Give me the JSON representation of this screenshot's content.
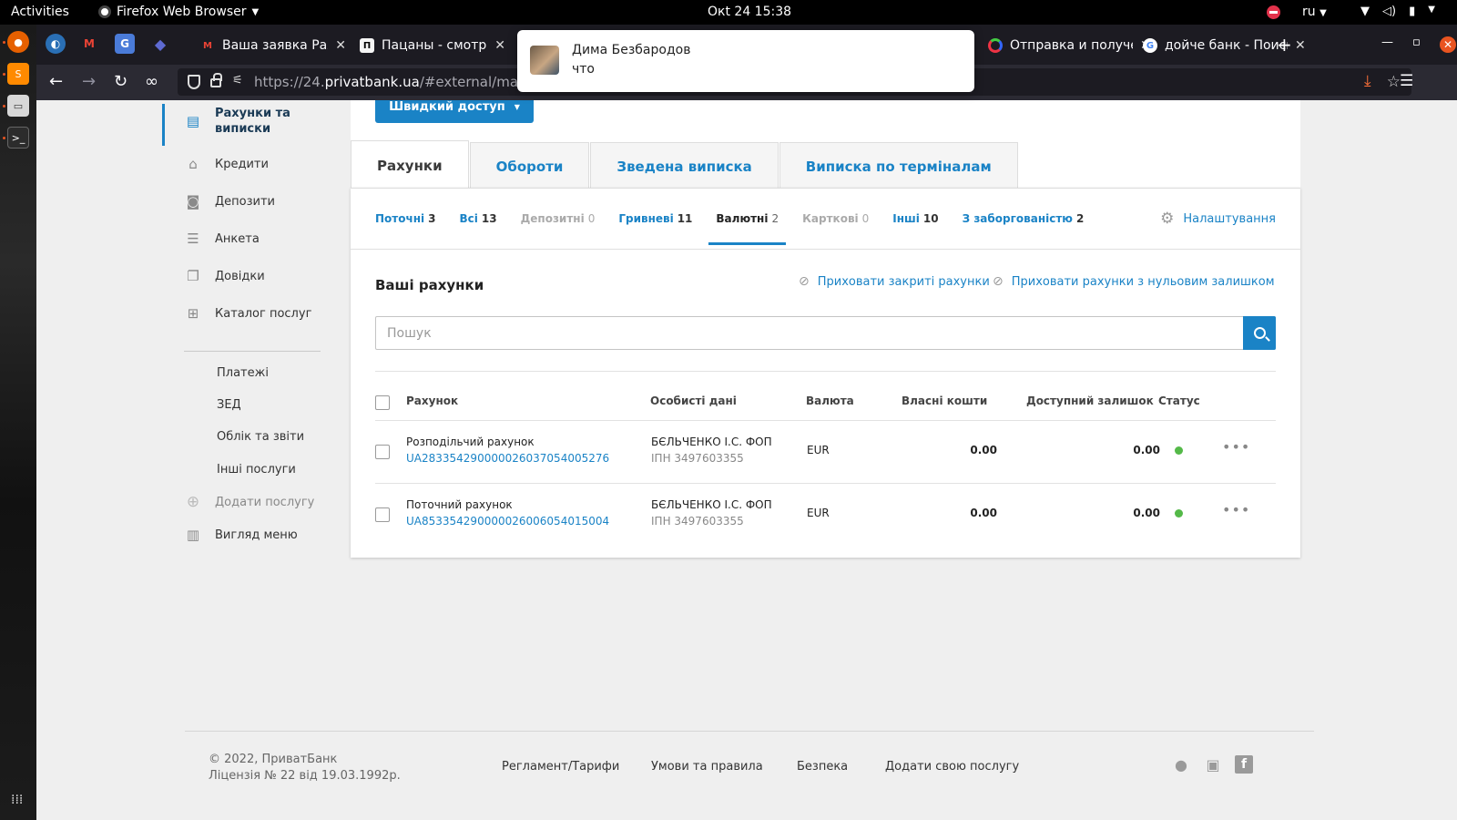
{
  "os": {
    "activities": "Activities",
    "app_menu": "Firefox Web Browser",
    "clock": "Окt 24  15:38",
    "lang": "ru"
  },
  "browser": {
    "tabs": [
      {
        "title": "Ваша заявка Рахунки",
        "favicon": "gmail-icon"
      },
      {
        "title": "Пацаны - смотреть",
        "favicon": "video-site-icon"
      },
      {
        "title": "Отправка и получение",
        "favicon": "colorful-ring-icon"
      },
      {
        "title": "дойче банк - Поиск",
        "favicon": "google-icon"
      }
    ],
    "url_host": "https://24.",
    "url_domain": "privatbank.ua",
    "url_path": "/#external/main",
    "new_tab": "+"
  },
  "notification": {
    "sender": "Дима Безбародов",
    "message": "что"
  },
  "sidebar": {
    "items": [
      {
        "label": "Рахунки та виписки",
        "icon": "document-list-icon",
        "active": true
      },
      {
        "label": "Кредити",
        "icon": "house-icon"
      },
      {
        "label": "Депозити",
        "icon": "deposit-icon"
      },
      {
        "label": "Анкета",
        "icon": "form-icon"
      },
      {
        "label": "Довідки",
        "icon": "certificates-icon"
      },
      {
        "label": "Каталог послуг",
        "icon": "catalog-icon"
      }
    ],
    "sub_items": [
      "Платежі",
      "ЗЕД",
      "Облік та звіти",
      "Інші послуги"
    ],
    "add_service": "Додати послугу",
    "menu_view": "Вигляд меню"
  },
  "main": {
    "quick_access": "Швидкий доступ",
    "tabs": [
      "Рахунки",
      "Обороти",
      "Зведена виписка",
      "Виписка по терміналам"
    ],
    "active_tab": 0,
    "filters": [
      {
        "label": "Поточні",
        "count": "3",
        "state": "link"
      },
      {
        "label": "Всі",
        "count": "13",
        "state": "link"
      },
      {
        "label": "Депозитні",
        "count": "0",
        "state": "disabled"
      },
      {
        "label": "Гривневі",
        "count": "11",
        "state": "link"
      },
      {
        "label": "Валютні",
        "count": "2",
        "state": "active"
      },
      {
        "label": "Карткові",
        "count": "0",
        "state": "disabled"
      },
      {
        "label": "Інші",
        "count": "10",
        "state": "link"
      },
      {
        "label": "З заборгованістю",
        "count": "2",
        "state": "link"
      }
    ],
    "settings_label": "Налаштування",
    "your_accounts": "Ваші рахунки",
    "hide_closed": "Приховати закриті рахунки",
    "hide_zero": "Приховати рахунки з нульовим залишком",
    "search_placeholder": "Пошук",
    "table": {
      "headers": [
        "Рахунок",
        "Особисті дані",
        "Валюта",
        "Власні кошти",
        "Доступний залишок",
        "Статус"
      ],
      "rows": [
        {
          "name": "Розподільчий рахунок",
          "iban": "UA283354290000026037054005276",
          "owner": "БЄЛЬЧЕНКО І.С. ФОП",
          "tax_id": "ІПН 3497603355",
          "currency": "EUR",
          "own_funds": "0.00",
          "available": "0.00",
          "status": "active"
        },
        {
          "name": "Поточний рахунок",
          "iban": "UA853354290000026006054015004",
          "owner": "БЄЛЬЧЕНКО І.С. ФОП",
          "tax_id": "ІПН 3497603355",
          "currency": "EUR",
          "own_funds": "0.00",
          "available": "0.00",
          "status": "active"
        }
      ]
    }
  },
  "footer": {
    "copyright": "© 2022, ПриватБанк",
    "license": "Ліцензія № 22 від 19.03.1992р.",
    "links": [
      "Регламент/Тарифи",
      "Умови та правила",
      "Безпека",
      "Додати свою послугу"
    ],
    "social": [
      "apple-icon",
      "android-icon",
      "facebook-icon"
    ]
  },
  "colors": {
    "accent": "#1a83c6",
    "status_active": "#54b948"
  }
}
